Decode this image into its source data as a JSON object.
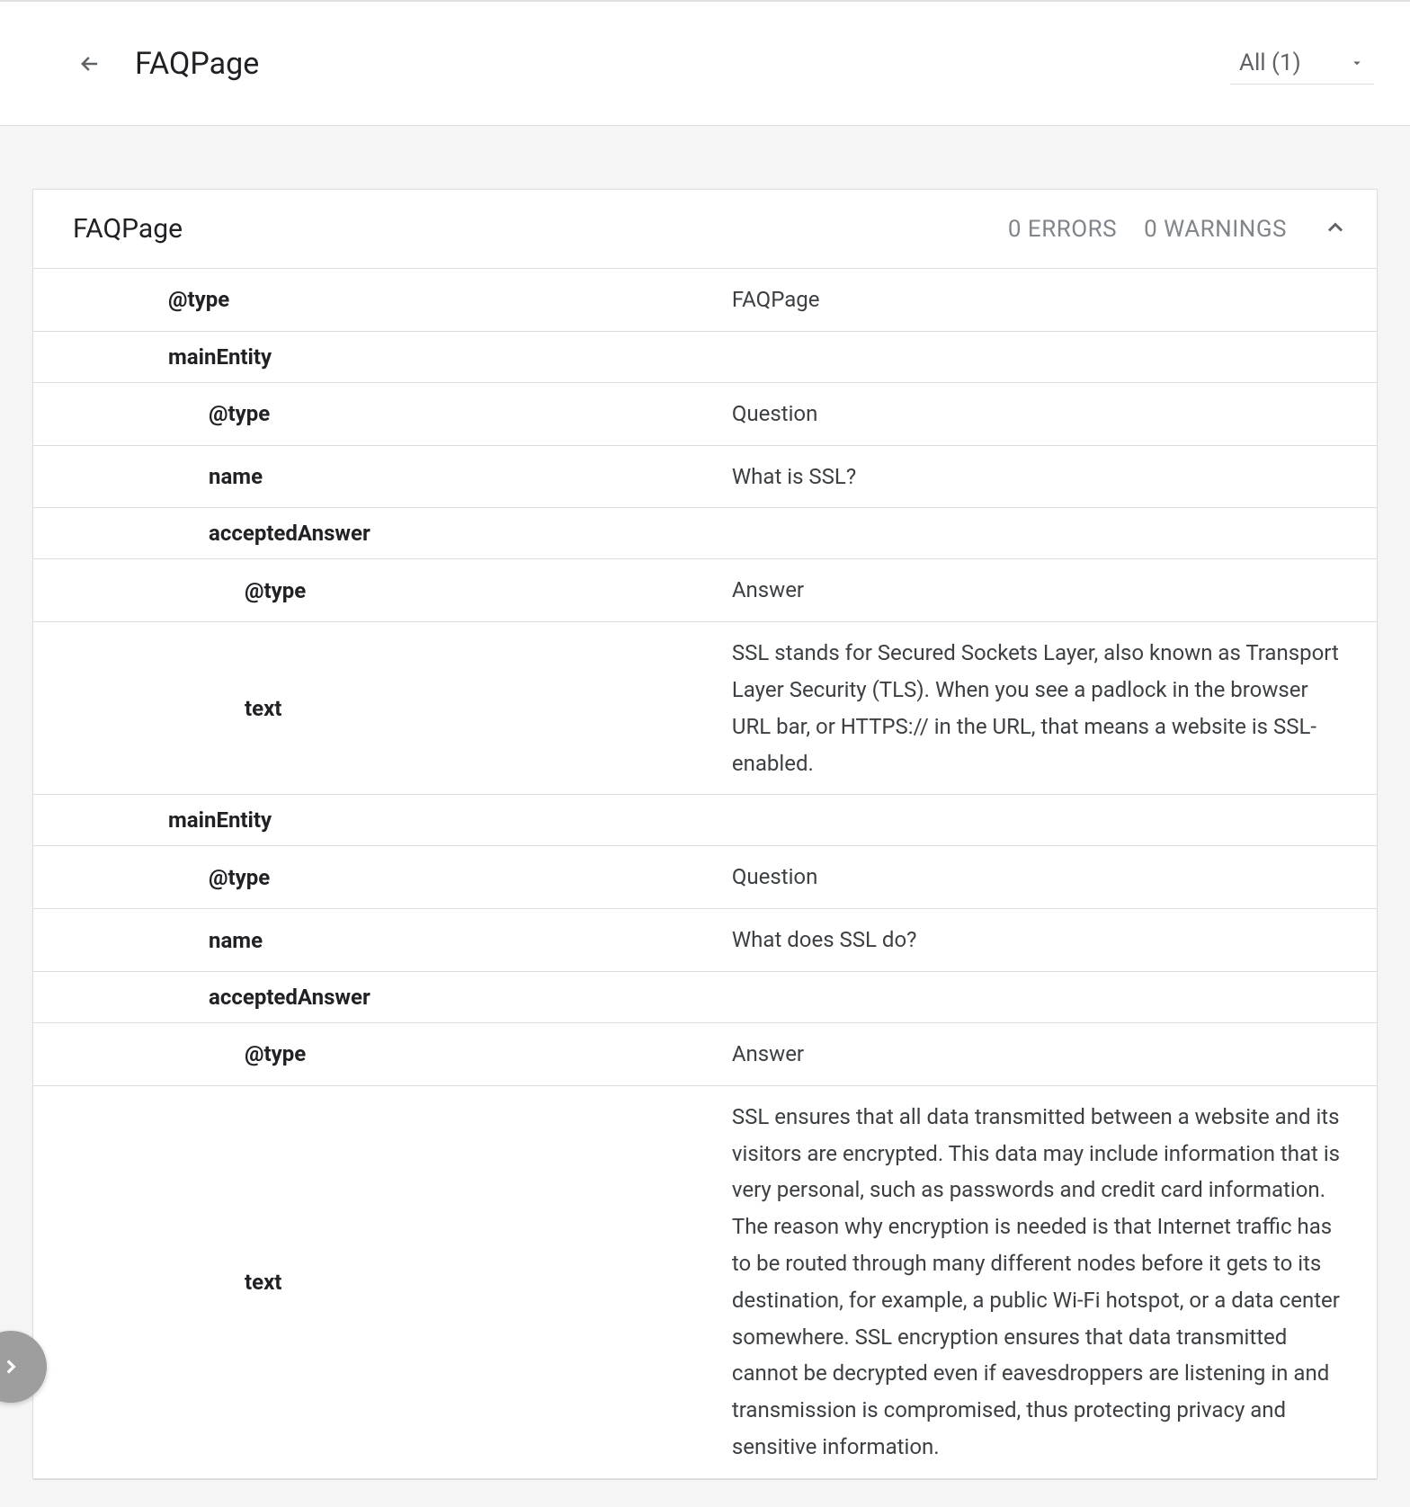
{
  "header": {
    "title": "FAQPage",
    "filter": "All (1)"
  },
  "card": {
    "title": "FAQPage",
    "errors": "0 ERRORS",
    "warnings": "0 WARNINGS"
  },
  "rows": [
    {
      "indent": 1,
      "key": "@type",
      "value": "FAQPage"
    },
    {
      "indent": 1,
      "key": "mainEntity",
      "value": ""
    },
    {
      "indent": 2,
      "key": "@type",
      "value": "Question"
    },
    {
      "indent": 2,
      "key": "name",
      "value": "What is SSL?"
    },
    {
      "indent": 2,
      "key": "acceptedAnswer",
      "value": ""
    },
    {
      "indent": 3,
      "key": "@type",
      "value": "Answer"
    },
    {
      "indent": 3,
      "key": "text",
      "value": "SSL stands for Secured Sockets Layer, also known as Transport Layer Security (TLS). When you see a padlock in the browser URL bar, or HTTPS:// in the URL, that means a website is SSL-enabled."
    },
    {
      "indent": 1,
      "key": "mainEntity",
      "value": ""
    },
    {
      "indent": 2,
      "key": "@type",
      "value": "Question"
    },
    {
      "indent": 2,
      "key": "name",
      "value": "What does SSL do?"
    },
    {
      "indent": 2,
      "key": "acceptedAnswer",
      "value": ""
    },
    {
      "indent": 3,
      "key": "@type",
      "value": "Answer"
    },
    {
      "indent": 3,
      "key": "text",
      "value": "SSL ensures that all data transmitted between a website and its visitors are encrypted. This data may include information that is very personal, such as passwords and credit card information. The reason why encryption is needed is that Internet traffic has to be routed through many different nodes before it gets to its destination, for example, a public Wi-Fi hotspot, or a data center somewhere. SSL encryption ensures that data transmitted cannot be decrypted even if eavesdroppers are listening in and transmission is compromised, thus protecting privacy and sensitive information."
    }
  ]
}
